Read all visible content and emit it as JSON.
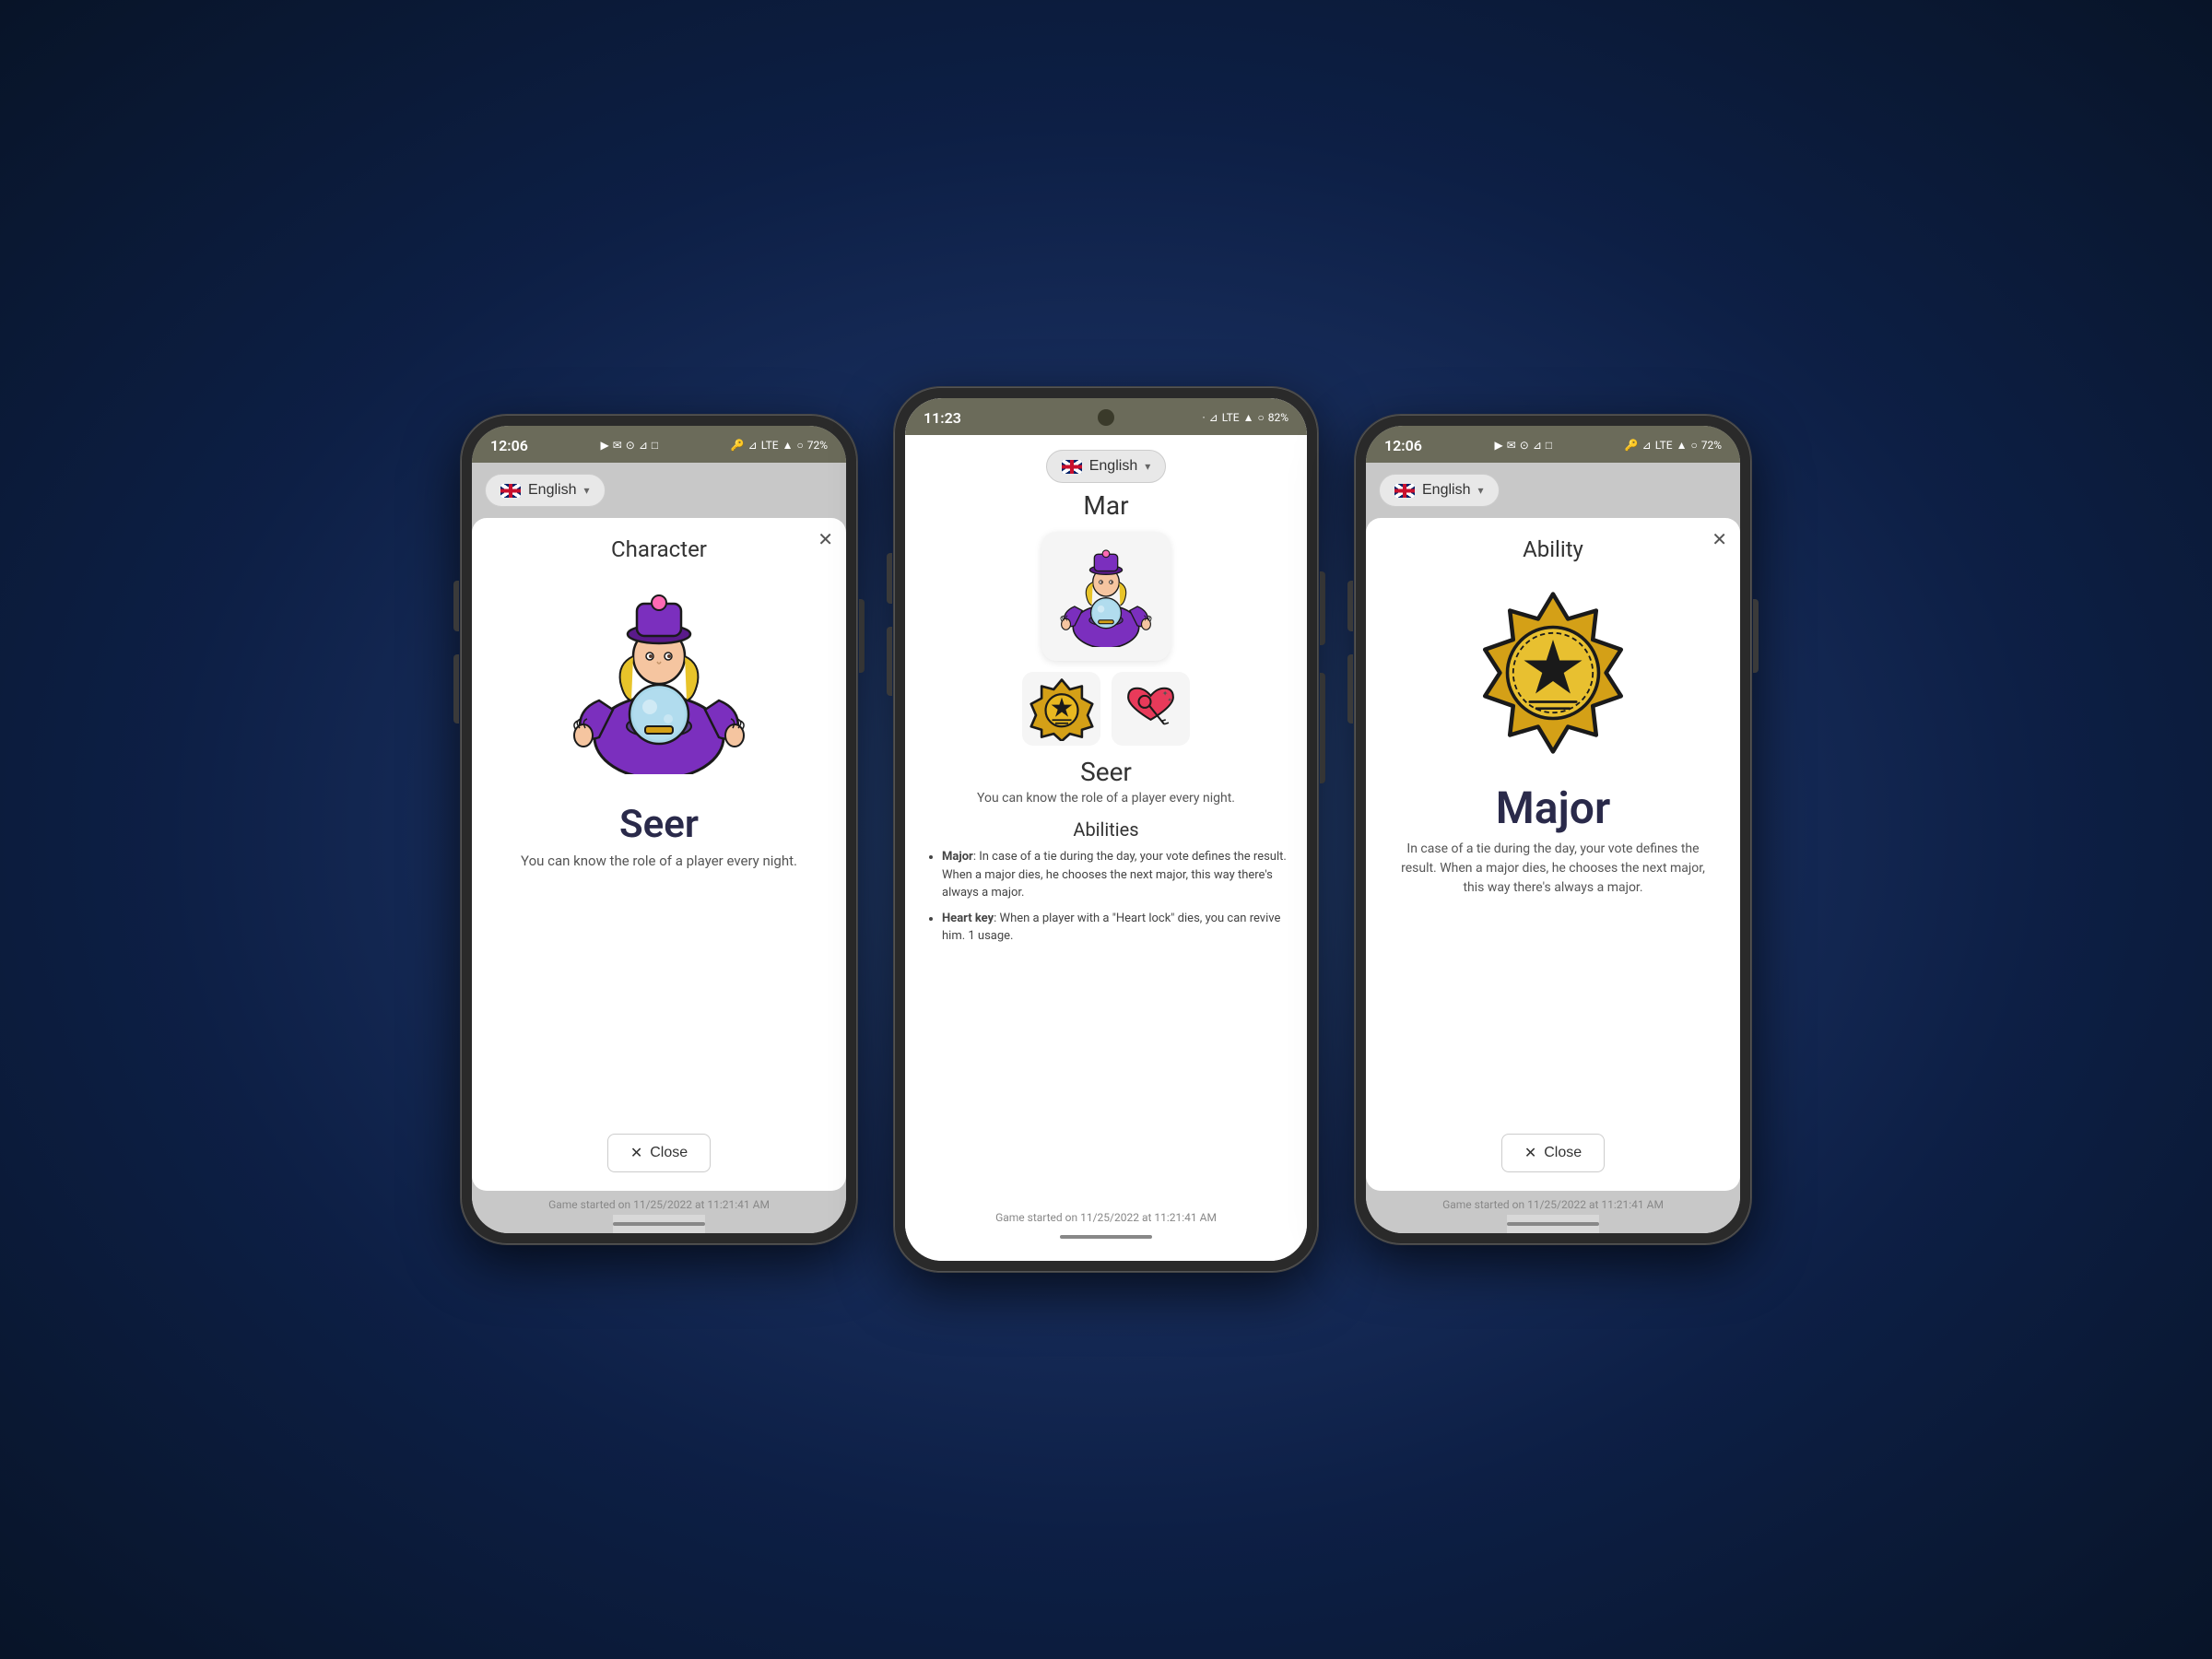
{
  "phone1": {
    "time": "12:06",
    "battery": "72%",
    "signal": "LTE",
    "language": "English",
    "modal_title": "Character",
    "character_name": "Seer",
    "character_desc": "You can know the role of a player every night.",
    "close_label": "Close",
    "footer": "Game started on 11/25/2022 at 11:21:41 AM"
  },
  "phone2": {
    "time": "11:23",
    "battery": "82%",
    "signal": "LTE",
    "language": "English",
    "player_name": "Mar",
    "role_name": "Seer",
    "role_desc": "You can know the role of a player every night.",
    "abilities_title": "Abilities",
    "ability1_name": "Major",
    "ability1_desc": "In case of a tie during the day, your vote defines the result. When a major dies, he chooses the next major, this way there's always a major.",
    "ability2_name": "Heart key",
    "ability2_desc": "When a player with a \"Heart lock\" dies, you can revive him. 1 usage.",
    "footer": "Game started on 11/25/2022 at 11:21:41 AM"
  },
  "phone3": {
    "time": "12:06",
    "battery": "72%",
    "signal": "LTE",
    "language": "English",
    "modal_title": "Ability",
    "ability_name": "Major",
    "ability_desc": "In case of a tie during the day, your vote defines the result. When a major dies, he chooses the next major, this way there's always a major.",
    "close_label": "Close",
    "footer": "Game started on 11/25/2022 at 11:21:41 AM"
  }
}
